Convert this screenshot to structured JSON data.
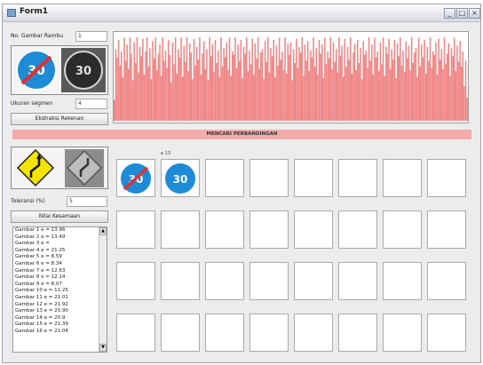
{
  "window": {
    "title": "Form1",
    "controls": {
      "minimize": "_",
      "maximize": "□",
      "close": "×"
    }
  },
  "left_top": {
    "gambar_label": "No. Gambar Rambu",
    "gambar_value": "1",
    "ukuran_label": "Ukuran segmen",
    "ukuran_value": "4",
    "ekstraksi_button": "Ekstraksi Rekenan"
  },
  "banner": "MENCARI PERBANDINGAN",
  "left_bottom": {
    "toleransi_label": "Toleransi (%)",
    "toleransi_value": "5",
    "nilai_button": "Nilai Kesamaan"
  },
  "list_items": [
    "Gambar 1   e = 13.96",
    "Gambar 2   e = 13.49",
    "Gambar 3   e = ",
    "Gambar 4   e = 21.25",
    "Gambar 5   e = 8.59",
    "Gambar 6   e = 8.34",
    "Gambar 7   e = 12.63",
    "Gambar 8   e = 12.14",
    "Gambar 9   e = 8.07",
    "Gambar 10   e = 11.25",
    "Gambar 11   e = 21.01",
    "Gambar 12   e = 21.92",
    "Gambar 13   e = 20.90",
    "Gambar 14   e = 20.9",
    "Gambar 15   e = 21.39",
    "Gambar 16   e = 21.04"
  ],
  "tile_caption": "e 13",
  "chart_data": {
    "type": "bar",
    "series_color": "#ef8585",
    "values": [
      18,
      62,
      55,
      70,
      48,
      60,
      38,
      72,
      52,
      66,
      45,
      75,
      58,
      35,
      68,
      50,
      74,
      42,
      64,
      56,
      71,
      40,
      60,
      77,
      47,
      63,
      36,
      69,
      54,
      73,
      44,
      58,
      66,
      39,
      75,
      52,
      61,
      46,
      70,
      57,
      33,
      68,
      49,
      76,
      41,
      62,
      55,
      72,
      38,
      65,
      51,
      74,
      43,
      67,
      59,
      36,
      71,
      48,
      64,
      53,
      77,
      40,
      58,
      69,
      45,
      62,
      35,
      73,
      56,
      66,
      42,
      70,
      50,
      61,
      38,
      75,
      47,
      63,
      55,
      68,
      44,
      72,
      39,
      60,
      57,
      74,
      46,
      66,
      52,
      70,
      37,
      64,
      58,
      76,
      43,
      61,
      49,
      71,
      40,
      67,
      54,
      73,
      45,
      59,
      62,
      36,
      69,
      51,
      75,
      42,
      63,
      56,
      70,
      38,
      65,
      48,
      72,
      53,
      60,
      44,
      74,
      41,
      67,
      57,
      68,
      35,
      62,
      50,
      71,
      46,
      64,
      59,
      73,
      39,
      66,
      52,
      69,
      43,
      61,
      55,
      75,
      47,
      63,
      40,
      70,
      58,
      66,
      37,
      72,
      49,
      60,
      54,
      74,
      45,
      68,
      51,
      62,
      42,
      73,
      56,
      65,
      38,
      71,
      47,
      64,
      53,
      76,
      41,
      59,
      67,
      44,
      70,
      50,
      63,
      36,
      69,
      57,
      61,
      46,
      74,
      52,
      66,
      40,
      72,
      55,
      60,
      43,
      68,
      49,
      75,
      39,
      64,
      58,
      71,
      45,
      62,
      53,
      70,
      37,
      67,
      56,
      73,
      48,
      61,
      42,
      69,
      54,
      65,
      44,
      76,
      50,
      59,
      63,
      38,
      72,
      47,
      66,
      55,
      70,
      41,
      64,
      52,
      74,
      46,
      60,
      57,
      68,
      40,
      71,
      53,
      62,
      45,
      75,
      49,
      58,
      67,
      39,
      63,
      56,
      72,
      43,
      65,
      51,
      69,
      47,
      60,
      30,
      52,
      20
    ]
  }
}
